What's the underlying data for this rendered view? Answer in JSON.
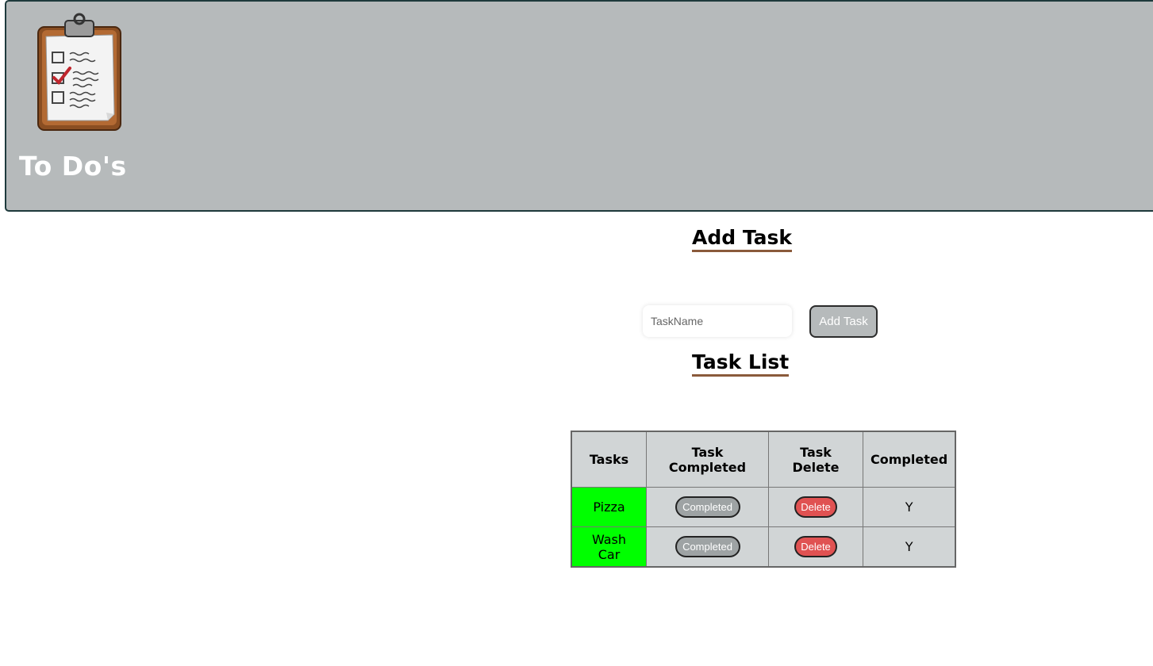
{
  "header": {
    "title": "To Do's",
    "logo_icon": "clipboard-checklist-icon"
  },
  "add_section": {
    "heading": "Add Task",
    "input_placeholder": "TaskName",
    "input_value": "",
    "add_button_label": "Add Task"
  },
  "list_section": {
    "heading": "Task List",
    "columns": [
      "Tasks",
      "Task Completed",
      "Task Delete",
      "Completed"
    ],
    "rows": [
      {
        "task": "Pizza",
        "complete_label": "Completed",
        "delete_label": "Delete",
        "completed": "Y"
      },
      {
        "task": "Wash Car",
        "complete_label": "Completed",
        "delete_label": "Delete",
        "completed": "Y"
      }
    ]
  },
  "colors": {
    "header_bg": "#b6babb",
    "completed_task_bg": "#00ff00",
    "delete_button": "#e05252",
    "heading_underline": "#8a5a3b"
  }
}
